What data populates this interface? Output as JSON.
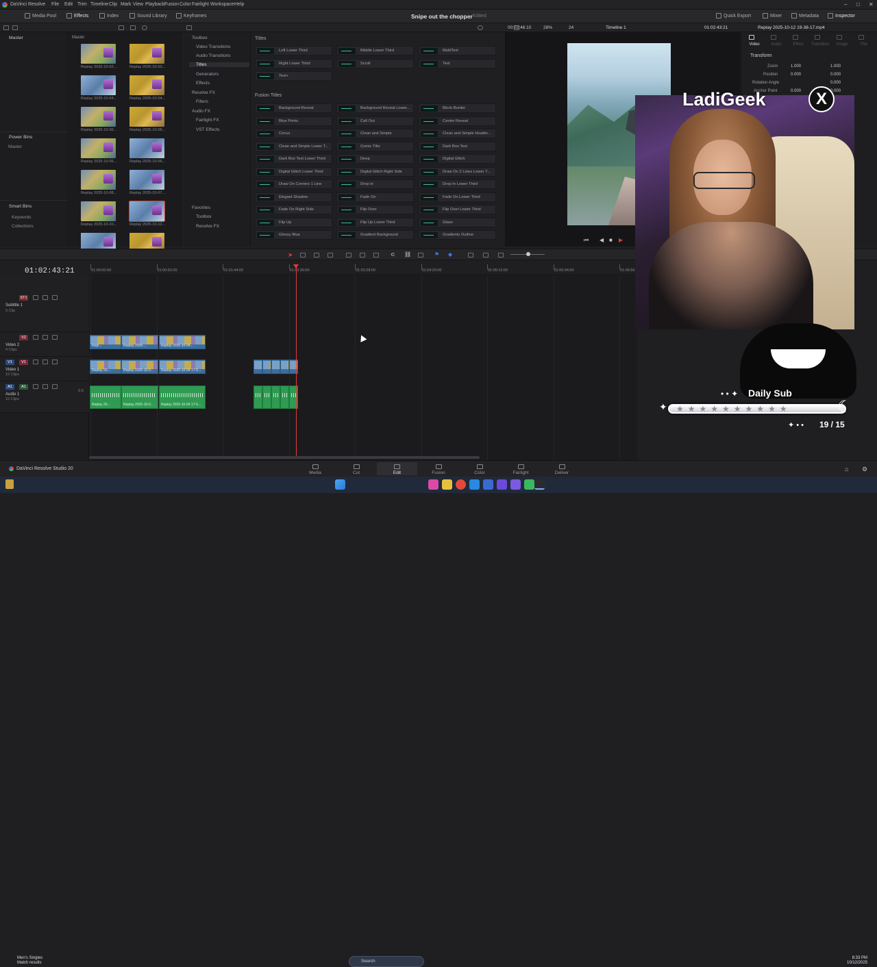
{
  "menu": {
    "app": "DaVinci Resolve",
    "items": [
      "File",
      "Edit",
      "Trim",
      "Timeline",
      "Clip",
      "Mark",
      "View",
      "Playback",
      "Fusion",
      "Color",
      "Fairlight",
      "Workspace",
      "Help"
    ]
  },
  "toolbar": {
    "media_pool": "Media Pool",
    "effects": "Effects",
    "index": "Index",
    "sound_library": "Sound Library",
    "keyframes": "Keyframes",
    "project_title": "Snipe out the chopper",
    "status": "Edited",
    "quick_export": "Quick Export",
    "mixer": "Mixer",
    "metadata": "Metadata",
    "inspector": "Inspector"
  },
  "media_pool": {
    "master_header": "Master",
    "master_col": "Master",
    "power_bins": "Power Bins",
    "power_master": "Master",
    "smart_bins": "Smart Bins",
    "keywords": "Keywords",
    "collections": "Collections",
    "thumbs": [
      "Replay 2025-10-02...",
      "Replay 2025-10-03...",
      "Replay 2025-10-04...",
      "Replay 2025-10-04...",
      "Replay 2025-10-06...",
      "Replay 2025-10-06...",
      "Replay 2025-10-06...",
      "Replay 2025-10-06...",
      "Replay 2025-10-08...",
      "Replay 2025-10-07...",
      "Replay 2025-10-10...",
      "Replay 2025-10-12...",
      "",
      ""
    ]
  },
  "toolbox": {
    "items": [
      "Toolbox",
      "Video Transitions",
      "Audio Transitions",
      "Titles",
      "Generators",
      "Effects",
      "Resolve FX",
      "Filters",
      "Audio FX",
      "Fairlight FX",
      "VST Effects",
      "Favorites",
      "Toolbox",
      "Resolve FX"
    ]
  },
  "effects": {
    "titles_header": "Titles",
    "titles": [
      "Left Lower Third",
      "Middle Lower Third",
      "MultiText",
      "Right Lower Third",
      "Scroll",
      "Text",
      "Text+"
    ],
    "fusion_header": "Fusion Titles",
    "fusion": [
      "Background Reveal",
      "Background Reveal Lower...",
      "Block Border",
      "Blue Prints",
      "Call Out",
      "Center Reveal",
      "Circus",
      "Clean and Simple",
      "Clean and Simple Headin...",
      "Clean and Simple Lower T...",
      "Comic Title",
      "Dark Box Text",
      "Dark Box Text Lower Third",
      "Deep",
      "Digital Glitch",
      "Digital Glitch Lower Third",
      "Digital Glitch Right Side",
      "Draw On 2 Lines Lower T...",
      "Draw On Corners 1 Line",
      "Drop In",
      "Drop In Lower Third",
      "Elegant Shadow",
      "Fade On",
      "Fade On Lower Third",
      "Fade On Right Side",
      "Flip Over",
      "Flip Over Lower Third",
      "Flip Up",
      "Flip Up Lower Third",
      "Glass",
      "Glossy Blue",
      "Gradient Background",
      "Gradients Outline"
    ]
  },
  "viewer": {
    "source_tc": "00:02:46:10",
    "zoom": "28%",
    "fps": "24",
    "timeline_name": "Timeline 1",
    "tc": "01:02:43:21"
  },
  "inspector": {
    "clip_name": "Replay 2025-10-12 19-38-17.mp4",
    "tabs": [
      "Video",
      "Audio",
      "Effect",
      "Transition",
      "Image",
      "File"
    ],
    "transform": "Transform",
    "zoom_label": "Zoom",
    "zoom_x": "1.000",
    "zoom_y": "1.000",
    "position_label": "Position",
    "pos_x": "0.000",
    "pos_y": "0.000",
    "rotation_label": "Rotation Angle",
    "rotation": "0.000",
    "anchor_label": "Anchor Point",
    "anchor_x": "0.000",
    "anchor_y": "0.000"
  },
  "timeline": {
    "timecode": "01:02:43:21",
    "ruler": [
      "01:00:00:00",
      "01:00:52:00",
      "01:01:44:00",
      "01:02:36:00",
      "01:03:28:00",
      "01:04:20:00",
      "01:05:12:00",
      "01:06:04:00",
      "01:06:56:0"
    ],
    "tracks": [
      {
        "tag": "ST1",
        "name": "Subtitle 1",
        "count": "0 Clip"
      },
      {
        "tag": "V2",
        "name": "Video 2",
        "count": "4 Clips"
      },
      {
        "tag": "V1",
        "name": "Video 1",
        "count": "10 Clips"
      },
      {
        "tag": "A1",
        "name": "Audio 1",
        "count": "10 Clips"
      }
    ],
    "audio_level": "2.0",
    "v2_clips": [
      "Repl...",
      "Replay 2025-...",
      "Replay 2025-10-04..."
    ],
    "v1_clips": [
      "Replay 20...",
      "Replay 2025-10-0...",
      "Replay 2025-10-04 17-5..."
    ],
    "a1_clips": [
      "Replay 20...",
      "Replay 2025-10-0...",
      "Replay 2025-10-04 17-5..."
    ]
  },
  "overlay": {
    "brand": "LadiGeek",
    "x_logo": "X",
    "daily_sub": "Daily Sub",
    "count": "19 / 15"
  },
  "pages": [
    "Media",
    "Cut",
    "Edit",
    "Fusion",
    "Color",
    "Fairlight",
    "Deliver"
  ],
  "active_page": "Edit",
  "resolve_label": "DaVinci Resolve Studio 20",
  "taskbar": {
    "song_title": "Men's Singles",
    "song_sub": "Match results",
    "search": "Search",
    "time": "8:33 PM",
    "date": "10/12/2025"
  }
}
